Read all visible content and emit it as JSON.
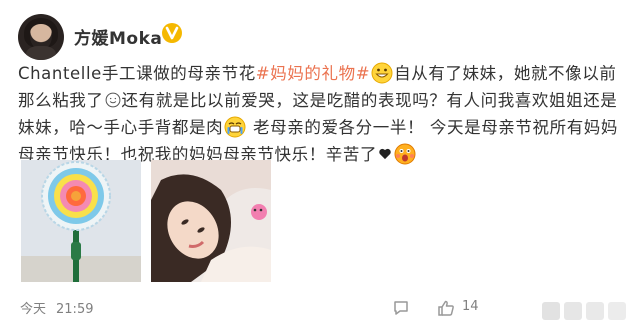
{
  "user": {
    "name": "方媛Moka",
    "verified_badge_icon": "verified-v-icon",
    "badge_color": "#f5b800"
  },
  "post": {
    "text_segments": [
      "Chantelle手工课做的母亲节花",
      "#妈妈的礼物#",
      "自从有了妹妹，她就不像以前那么粘我了",
      "还有就是比以前爱哭，这是吃醋的表现吗？有人问我喜欢姐姐还是妹妹，哈～手心手背都是肉",
      " 老母亲的爱各分一半！ 今天是母亲节祝所有妈妈母亲节快乐！也祝我的妈妈母亲节快乐！辛苦了"
    ],
    "hashtag_color": "#eb7350",
    "emoticons": [
      "grin-emoji",
      "smile-emoji",
      "teary-emoji",
      "heart-icon",
      "surprised-emoji"
    ]
  },
  "images": [
    {
      "name": "paper-flower-photo"
    },
    {
      "name": "selfie-photo"
    }
  ],
  "footer": {
    "date": "今天",
    "time": "21:59",
    "comment_icon": "comment-icon",
    "like_icon": "like-icon",
    "like_count": "14"
  }
}
